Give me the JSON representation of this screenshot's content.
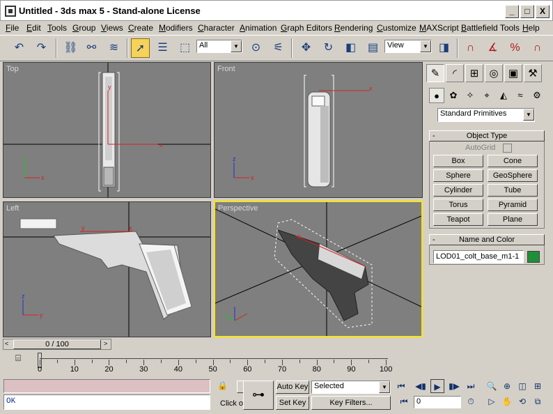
{
  "window": {
    "title": "Untitled - 3ds max 5 - Stand-alone License",
    "minimize": "_",
    "maximize": "□",
    "close": "X"
  },
  "menu": [
    "File",
    "Edit",
    "Tools",
    "Group",
    "Views",
    "Create",
    "Modifiers",
    "Character",
    "Animation",
    "Graph Editors",
    "Rendering",
    "Customize",
    "MAXScript",
    "Battlefield Tools",
    "Help"
  ],
  "toolbar": {
    "selection_filter": "All",
    "reference_coord": "View"
  },
  "viewports": {
    "top": "Top",
    "front": "Front",
    "left": "Left",
    "perspective": "Perspective"
  },
  "command_panel": {
    "category": "Standard Primitives",
    "object_type_title": "Object Type",
    "autogrid": "AutoGrid",
    "buttons": [
      "Box",
      "Cone",
      "Sphere",
      "GeoSphere",
      "Cylinder",
      "Tube",
      "Torus",
      "Pyramid",
      "Teapot",
      "Plane"
    ],
    "name_color_title": "Name and Color",
    "object_name": "LOD01_colt_base_m1-1",
    "object_color": "#1f8f3a",
    "minus": "-"
  },
  "timeline": {
    "slider_label": "0 / 100",
    "ticks": [
      "0",
      "10",
      "20",
      "30",
      "40",
      "50",
      "60",
      "70",
      "80",
      "90",
      "100"
    ]
  },
  "status": {
    "maxscript_output": "OK",
    "prompt": "Click o",
    "auto_key": "Auto Key",
    "set_key": "Set Key",
    "key_mode": "Selected",
    "key_filters": "Key Filters...",
    "frame": "0"
  },
  "colors": {
    "viewport_bg": "#7f7f7f",
    "active_viewport": "#ffe600",
    "axis_x": "#d42020",
    "axis_y": "#20c020",
    "axis_z": "#2030c8"
  }
}
